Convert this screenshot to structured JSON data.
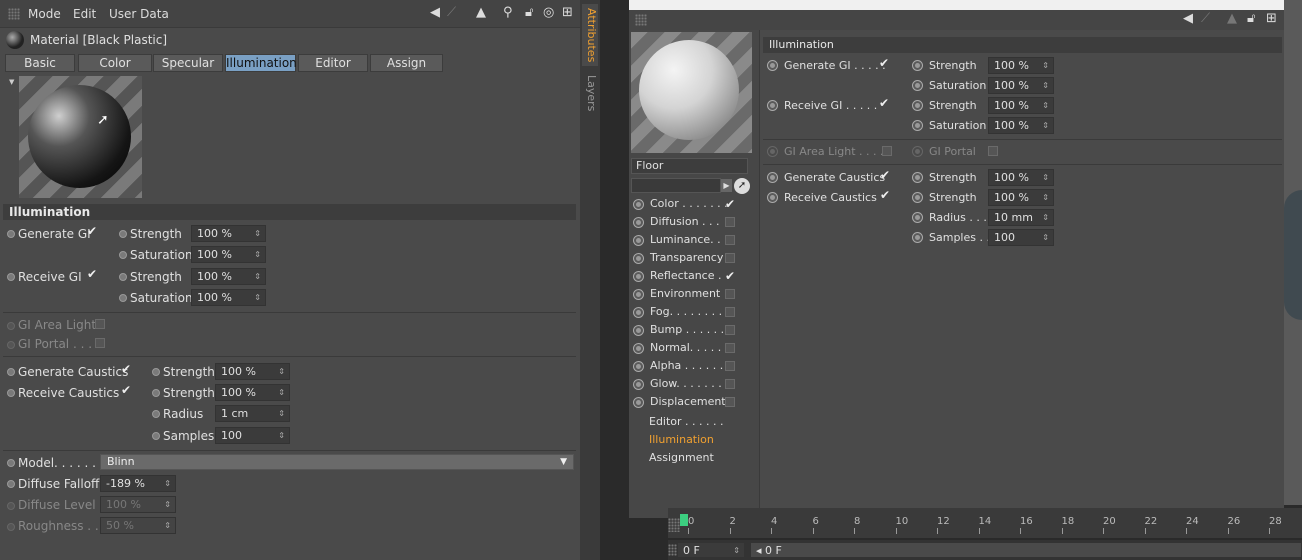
{
  "menu": {
    "mode": "Mode",
    "edit": "Edit",
    "user_data": "User Data"
  },
  "material": {
    "title": "Material [Black Plastic]"
  },
  "tabs": [
    "Basic",
    "Color",
    "Specular",
    "Illumination",
    "Editor",
    "Assign"
  ],
  "active_tab": "Illumination",
  "vertical_tabs": {
    "attributes": "Attributes",
    "layers": "Layers"
  },
  "left": {
    "section": "Illumination",
    "generate_gi": "Generate GI",
    "receive_gi": "Receive GI",
    "strength": "Strength",
    "saturation": "Saturation",
    "gi_gen_strength": "100 %",
    "gi_gen_saturation": "100 %",
    "gi_rec_strength": "100 %",
    "gi_rec_saturation": "100 %",
    "gi_area_light": "GI Area Light",
    "gi_portal": "GI Portal . . .",
    "generate_caustics": "Generate Caustics",
    "receive_caustics": "Receive Caustics",
    "radius": "Radius",
    "samples": "Samples",
    "caus_gen_strength": "100 %",
    "caus_rec_strength": "100 %",
    "caus_radius": "1 cm",
    "caus_samples": "100",
    "model_label": "Model. . . . . . .",
    "model_value": "Blinn",
    "diffuse_falloff": "Diffuse Falloff",
    "diffuse_falloff_value": "-189 %",
    "diffuse_level": "Diffuse Level",
    "diffuse_level_value": "100 %",
    "roughness": "Roughness . .",
    "roughness_value": "50 %"
  },
  "right": {
    "section": "Illumination",
    "generate_gi": "Generate GI . . . . .",
    "receive_gi": "Receive GI . . . . .",
    "strength": "Strength",
    "saturation": "Saturation",
    "gi_gen_strength": "100 %",
    "gi_gen_saturation": "100 %",
    "gi_rec_strength": "100 %",
    "gi_rec_saturation": "100 %",
    "gi_area_light": "GI Area Light . . . .",
    "gi_portal": "GI Portal",
    "generate_caustics": "Generate Caustics",
    "receive_caustics": "Receive Caustics",
    "radius": "Radius . . .",
    "samples": "Samples . .",
    "caus_gen_strength": "100 %",
    "caus_rec_strength": "100 %",
    "caus_radius": "10 mm",
    "caus_samples": "100"
  },
  "material_name": "Floor",
  "channels": [
    {
      "label": "Color . . . . . . .",
      "checked": true
    },
    {
      "label": "Diffusion . . .",
      "checked": false
    },
    {
      "label": "Luminance. .",
      "checked": false
    },
    {
      "label": "Transparency",
      "checked": false
    },
    {
      "label": "Reflectance .",
      "checked": true
    },
    {
      "label": "Environment",
      "checked": false
    },
    {
      "label": "Fog. . . . . . . .",
      "checked": false
    },
    {
      "label": "Bump . . . . . .",
      "checked": false
    },
    {
      "label": "Normal. . . . .",
      "checked": false
    },
    {
      "label": "Alpha . . . . . .",
      "checked": false
    },
    {
      "label": "Glow. . . . . . .",
      "checked": false
    },
    {
      "label": "Displacement",
      "checked": false
    }
  ],
  "extras": {
    "editor": "Editor . . . . . .",
    "illumination": "Illumination",
    "assignment": "Assignment"
  },
  "timeline": {
    "ticks": [
      "0",
      "2",
      "4",
      "6",
      "8",
      "10",
      "12",
      "14",
      "16",
      "18",
      "20",
      "22",
      "24",
      "26",
      "28"
    ],
    "frame_field": "0 F",
    "frame_field2": "0 F"
  },
  "colors": {
    "accent": "#f0a030",
    "tab_active": "#7aa0c4"
  }
}
